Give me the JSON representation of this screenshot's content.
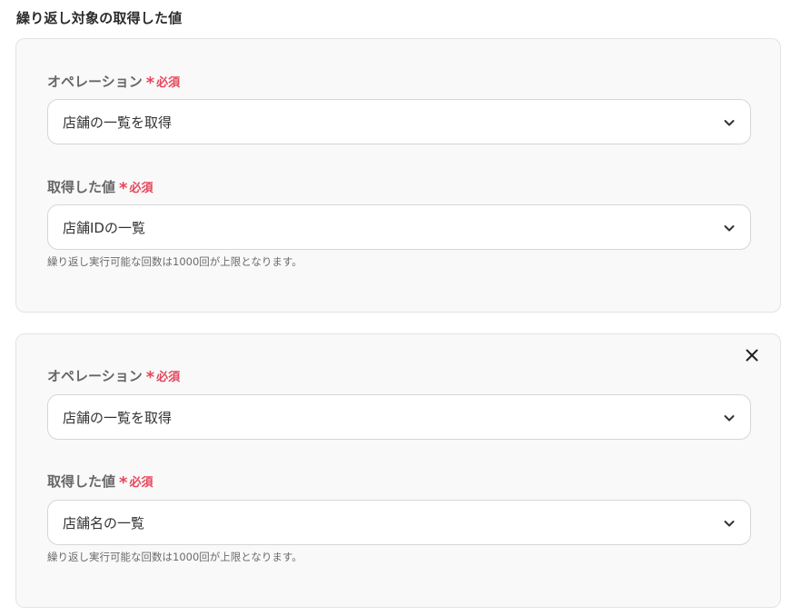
{
  "section": {
    "title": "繰り返し対象の取得した値"
  },
  "cards": [
    {
      "operation": {
        "label": "オペレーション",
        "required_star": "*",
        "required_text": "必須",
        "value": "店舗の一覧を取得"
      },
      "value_field": {
        "label": "取得した値",
        "required_star": "*",
        "required_text": "必須",
        "value": "店舗IDの一覧"
      },
      "helper": "繰り返し実行可能な回数は1000回が上限となります。"
    },
    {
      "operation": {
        "label": "オペレーション",
        "required_star": "*",
        "required_text": "必須",
        "value": "店舗の一覧を取得"
      },
      "value_field": {
        "label": "取得した値",
        "required_star": "*",
        "required_text": "必須",
        "value": "店舗名の一覧"
      },
      "helper": "繰り返し実行可能な回数は1000回が上限となります。",
      "close_icon": "close-icon"
    }
  ],
  "colors": {
    "required": "#e5475b",
    "card_background": "#f9f9f9",
    "card_border": "#e3e3e3",
    "label": "#666666"
  }
}
